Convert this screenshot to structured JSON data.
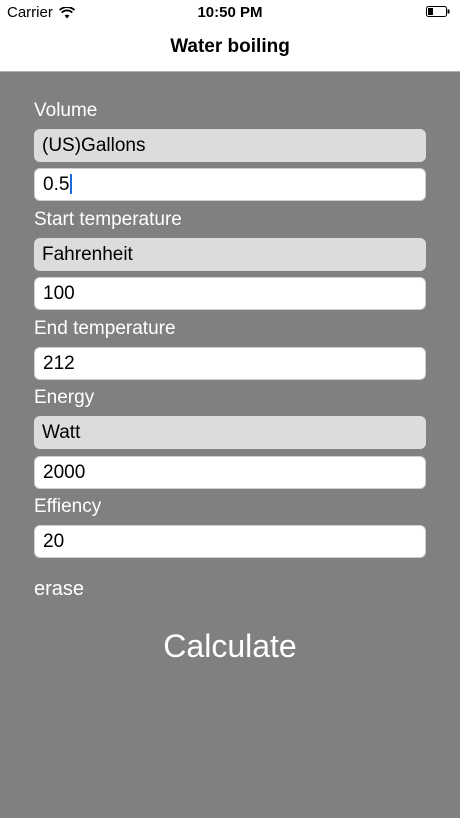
{
  "status_bar": {
    "carrier": "Carrier",
    "time": "10:50 PM",
    "icons": [
      "wifi-icon",
      "battery-icon"
    ]
  },
  "nav": {
    "title": "Water boiling"
  },
  "form": {
    "volume_label": "Volume",
    "volume_unit": "(US)Gallons",
    "volume_value": "0.5",
    "start_temp_label": "Start temperature",
    "start_temp_unit": "Fahrenheit",
    "start_temp_value": "100",
    "end_temp_label": "End temperature",
    "end_temp_value": "212",
    "energy_label": "Energy",
    "energy_unit": "Watt",
    "energy_value": "2000",
    "efficiency_label": "Effiency",
    "efficiency_value": "20"
  },
  "actions": {
    "erase_label": "erase",
    "calculate_label": "Calculate"
  },
  "colors": {
    "background": "#808080",
    "selector": "#dcdcdc",
    "caret": "#1c6bd6"
  }
}
